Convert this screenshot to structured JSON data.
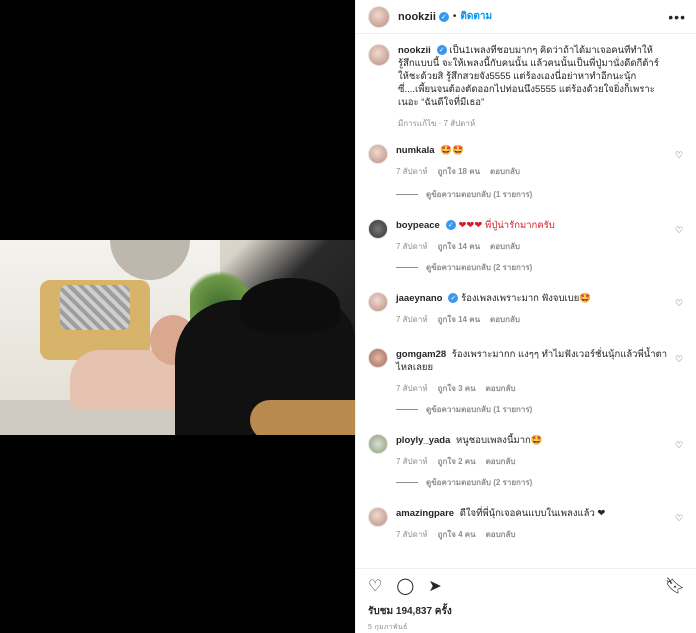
{
  "post": {
    "username": "nookzii",
    "follow_label": "ติดตาม",
    "views": "รับชม 194,837 ครั้ง",
    "date": "5 กุมภาพันธ์"
  },
  "caption": {
    "username": "nookzii",
    "text": "เป็น1เพลงที่ชอบมากๆ คิดว่าถ้าได้มาเจอคนที่ทำให้รู้สึกแบบนี้ จะให้เพลงนี้กับคนนั้น แล้วคนนั้นเป็นพี่ปู่มานั่งดีดกีต้าร์ให้ชะด้วยสิ รู้สึกสวยจัง5555 แต่ร้องเองนี่อย่าหาทำอีกนะนุ้กซี่....เพี้ยนจนต้องตัดออกไปท่อนนึง5555 แต่ร้องด้วยใจยิ่งก็เพราะเนอะ “ฉันดีใจที่มีเธอ”",
    "meta": "มีการแก้ไข · 7 สัปดาห์"
  },
  "comments": [
    {
      "username": "numkala",
      "text": "🤩🤩",
      "time": "7 สัปดาห์",
      "likes": "ถูกใจ 18 คน",
      "reply": "ตอบกลับ",
      "view_replies": "ดูข้อความตอบกลับ (1 รายการ)",
      "verified": false
    },
    {
      "username": "boypeace",
      "text": "❤❤❤ พี่ปู่น่ารักมากครับ",
      "time": "7 สัปดาห์",
      "likes": "ถูกใจ 14 คน",
      "reply": "ตอบกลับ",
      "view_replies": "ดูข้อความตอบกลับ (2 รายการ)",
      "verified": true
    },
    {
      "username": "jaaeynano",
      "text": "ร้องเพลงเพราะมาก ฟังจบเบย🤩",
      "time": "7 สัปดาห์",
      "likes": "ถูกใจ 14 คน",
      "reply": "ตอบกลับ",
      "view_replies": "",
      "verified": true
    },
    {
      "username": "gomgam28",
      "text": "ร้องเพราะมากก แงๆๆ ทำไมฟังเวอร์ชั่นนุ้กแล้วพี่น้ำตาไหลเลยย",
      "time": "7 สัปดาห์",
      "likes": "ถูกใจ 3 คน",
      "reply": "ตอบกลับ",
      "view_replies": "ดูข้อความตอบกลับ (1 รายการ)",
      "verified": false
    },
    {
      "username": "ployly_yada",
      "text": "หนูชอบเพลงนี้มาก🤩",
      "time": "7 สัปดาห์",
      "likes": "ถูกใจ 2 คน",
      "reply": "ตอบกลับ",
      "view_replies": "ดูข้อความตอบกลับ (2 รายการ)",
      "verified": false
    },
    {
      "username": "amazingpare",
      "text": "ดีใจที่พี่นุ้กเจอคนแบบในเพลงแล้ว ❤",
      "time": "7 สัปดาห์",
      "likes": "ถูกใจ 4 คน",
      "reply": "ตอบกลับ",
      "view_replies": "",
      "verified": false
    }
  ],
  "icons": {
    "like": "heart-icon",
    "comment": "comment-icon",
    "share": "paper-plane-icon",
    "save": "bookmark-icon",
    "more": "more-icon"
  }
}
